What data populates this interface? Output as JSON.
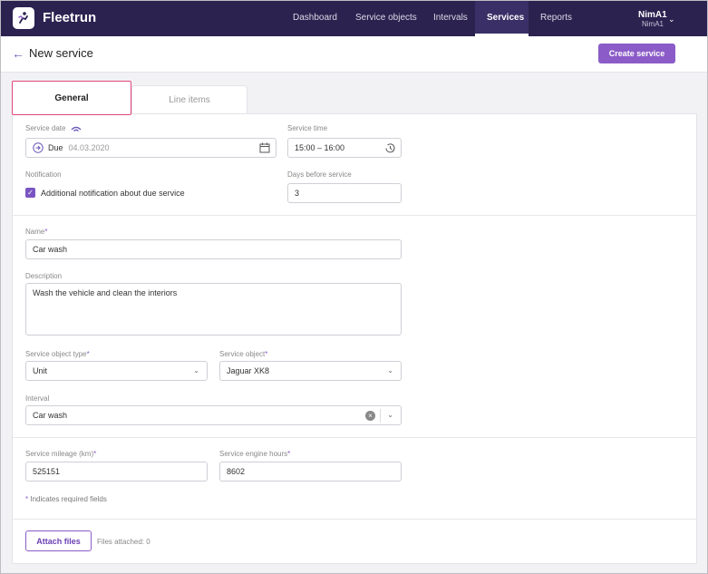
{
  "app": {
    "name": "Fleetrun"
  },
  "nav": {
    "items": [
      {
        "label": "Dashboard"
      },
      {
        "label": "Service objects"
      },
      {
        "label": "Intervals"
      },
      {
        "label": "Services"
      },
      {
        "label": "Reports"
      }
    ]
  },
  "user": {
    "name": "NimA1",
    "sub": "NimA1"
  },
  "header": {
    "title": "New service",
    "create_label": "Create service"
  },
  "tabs": {
    "general": "General",
    "line_items": "Line items"
  },
  "form": {
    "service_date": {
      "label": "Service date",
      "mode": "Due",
      "value": "04.03.2020"
    },
    "service_time": {
      "label": "Service time",
      "value": "15:00 – 16:00"
    },
    "notification": {
      "label": "Notification",
      "checkbox_label": "Additional notification about due service",
      "checked": true
    },
    "days_before": {
      "label": "Days before service",
      "value": "3"
    },
    "name": {
      "label": "Name",
      "value": "Car wash"
    },
    "description": {
      "label": "Description",
      "value": "Wash the vehicle and clean the interiors"
    },
    "object_type": {
      "label": "Service object type",
      "value": "Unit"
    },
    "object": {
      "label": "Service object",
      "value": "Jaguar XK8"
    },
    "interval": {
      "label": "Interval",
      "value": "Car wash"
    },
    "mileage": {
      "label": "Service mileage (km)",
      "value": "525151"
    },
    "engine_hours": {
      "label": "Service engine hours",
      "value": "8602"
    },
    "required_note": "Indicates required fields",
    "required_mark": "*"
  },
  "attach": {
    "button_label": "Attach files",
    "status": "Files attached: 0"
  },
  "colors": {
    "topbar": "#2b2250",
    "accent": "#8b5cc7",
    "highlight": "#e0457a"
  }
}
